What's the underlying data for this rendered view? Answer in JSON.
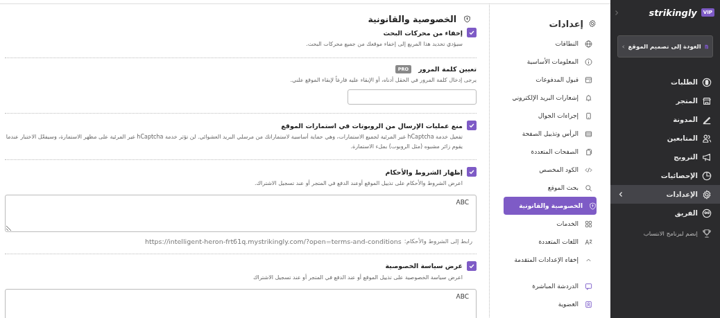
{
  "app_sidebar": {
    "logo": "strikingly",
    "badge": "VIP",
    "back_button": "العودة إلى تصميم الموقع",
    "items": [
      {
        "label": "الطلبات",
        "selected": false
      },
      {
        "label": "المتجر",
        "selected": false
      },
      {
        "label": "المدونة",
        "selected": false
      },
      {
        "label": "المتابعين",
        "selected": false
      },
      {
        "label": "الترويج",
        "selected": false
      },
      {
        "label": "الإحصائيات",
        "selected": false
      },
      {
        "label": "الإعدادات",
        "selected": true
      },
      {
        "label": "الفريق",
        "selected": false
      }
    ],
    "affiliate": "إنضم لبرنامج الانتساب"
  },
  "settings_menu": {
    "title": "إعدادات",
    "items": [
      {
        "label": "النطاقات",
        "selected": false
      },
      {
        "label": "المعلومات الأساسية",
        "selected": false
      },
      {
        "label": "قبول المدفوعات",
        "selected": false
      },
      {
        "label": "إشعارات البريد الإلكتروني",
        "selected": false
      },
      {
        "label": "إجراءات الجوال",
        "selected": false
      },
      {
        "label": "الرأس وتذييل الصفحة",
        "selected": false
      },
      {
        "label": "الصفحات المتعددة",
        "selected": false
      },
      {
        "label": "الكود المخصص",
        "selected": false
      },
      {
        "label": "بحث الموقع",
        "selected": false
      },
      {
        "label": "الخصوصية والقانونية",
        "selected": true
      },
      {
        "label": "الخدمات",
        "selected": false
      },
      {
        "label": "اللغات المتعددة",
        "selected": false
      }
    ],
    "advanced_toggle": {
      "label": "إخفاء الإعدادات المتقدمة",
      "expanded": true
    },
    "advanced_items": [
      {
        "label": "الدردشة المباشرة",
        "selected": false
      },
      {
        "label": "العضوية",
        "selected": false
      }
    ]
  },
  "page": {
    "title": "الخصوصية والقانونية",
    "sections": [
      {
        "kind": "checkbox",
        "checked": true,
        "label": "إخفاء من محركات البحث",
        "description": "سيؤدي تحديد هذا المربع إلى إخفاء موقعك من جميع محركات البحث."
      },
      {
        "kind": "password",
        "label": "تعيين كلمة المرور",
        "badge": "PRO",
        "description": "يرجى إدخال كلمة المرور في الحقل أدناه، أو الإبقاء عليه فارغاً لإبقاء الموقع علني."
      },
      {
        "kind": "checkbox",
        "checked": true,
        "label": "منع عمليات الإرسال من الروبوتات في استمارات الموقع",
        "description": "تفعيل خدمة hCaptcha غير المرئية لجميع الاستمارات، وهي حماية أساسية لاستماراتك من مرسلي البريد العشوائي. لن تؤثر خدمة hCaptcha غير المرئية على مظهر الاستمارة، وسيفعّل الاختبار عندما يقوم زائر مشبوه (مثل الروبوت) بملء الاستمارة."
      },
      {
        "kind": "checkbox",
        "checked": true,
        "label": "إظهار الشروط والأحكام",
        "description": "اعرض الشروط والأحكام على تذييل الموقع أوعند الدفع في المتجر أو عند تسجيل الاشتراك.",
        "text": "ABC",
        "link_label": "رابط إلى الشروط والأحكام:",
        "link": "https://intelligent-heron-frt61q.mystrikingly.com/?open=terms-and-conditions"
      },
      {
        "kind": "checkbox",
        "checked": true,
        "label": "عرض سياسة الخصوصية",
        "description": "اعرض سياسة الخصوصية على تذييل الموقع أو عند الدفع في المتجر أو عند تسجيل الاشتراك",
        "text": "ABC"
      }
    ]
  }
}
